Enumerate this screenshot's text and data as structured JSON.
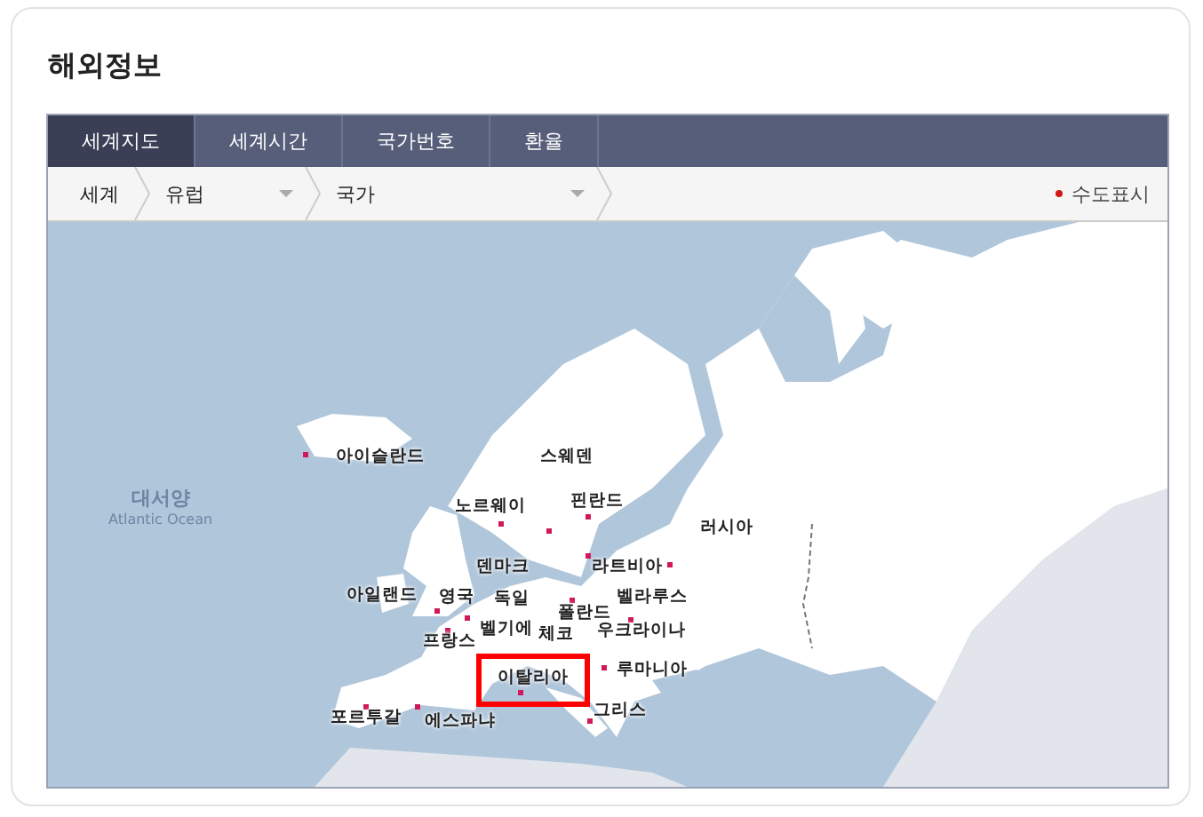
{
  "title": "해외정보",
  "tabs": [
    {
      "label": "세계지도",
      "selected": true
    },
    {
      "label": "세계시간",
      "selected": false
    },
    {
      "label": "국가번호",
      "selected": false
    },
    {
      "label": "환율",
      "selected": false
    }
  ],
  "breadcrumb": {
    "root": "세계",
    "region": "유럽",
    "country": "국가"
  },
  "capital_legend": "수도표시",
  "ocean": {
    "name": "대서양",
    "subtitle": "Atlantic Ocean"
  },
  "countries": [
    {
      "name": "아이슬란드",
      "selected": false
    },
    {
      "name": "스웨덴",
      "selected": false
    },
    {
      "name": "노르웨이",
      "selected": false
    },
    {
      "name": "핀란드",
      "selected": false
    },
    {
      "name": "러시아",
      "selected": false
    },
    {
      "name": "덴마크",
      "selected": false
    },
    {
      "name": "라트비아",
      "selected": false
    },
    {
      "name": "아일랜드",
      "selected": false
    },
    {
      "name": "영국",
      "selected": false
    },
    {
      "name": "독일",
      "selected": false
    },
    {
      "name": "벨라루스",
      "selected": false
    },
    {
      "name": "폴란드",
      "selected": false
    },
    {
      "name": "벨기에",
      "selected": false
    },
    {
      "name": "체코",
      "selected": false
    },
    {
      "name": "우크라이나",
      "selected": false
    },
    {
      "name": "프랑스",
      "selected": false
    },
    {
      "name": "이탈리아",
      "selected": true
    },
    {
      "name": "루마니아",
      "selected": false
    },
    {
      "name": "포르투갈",
      "selected": false
    },
    {
      "name": "에스파냐",
      "selected": false
    },
    {
      "name": "그리스",
      "selected": false
    }
  ]
}
